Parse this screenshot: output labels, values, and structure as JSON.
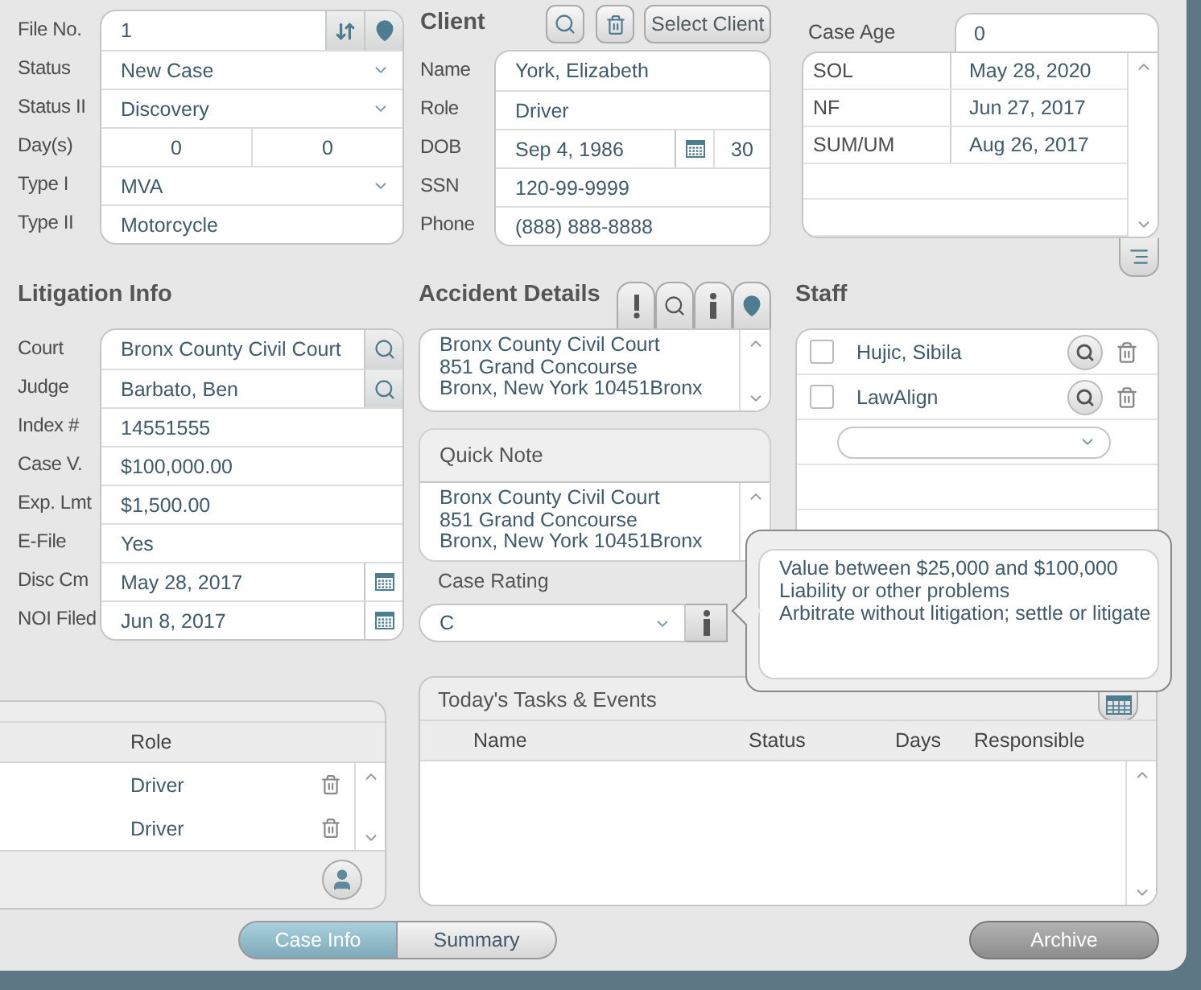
{
  "case": {
    "fields": [
      {
        "label": "File No.",
        "kind": "file",
        "value": "1"
      },
      {
        "label": "Status",
        "kind": "select",
        "value": "New Case"
      },
      {
        "label": "Status II",
        "kind": "select",
        "value": "Discovery"
      },
      {
        "label": "Day(s)",
        "kind": "pair",
        "value": "0",
        "value_2": "0"
      },
      {
        "label": "Type I",
        "kind": "select",
        "value": "MVA"
      },
      {
        "label": "Type II",
        "kind": "text",
        "value": "Motorcycle"
      }
    ]
  },
  "client": {
    "title": "Client",
    "select_button": "Select Client",
    "fields": [
      {
        "label": "Name",
        "kind": "text",
        "value": "York, Elizabeth"
      },
      {
        "label": "Role",
        "kind": "text",
        "value": "Driver"
      },
      {
        "label": "DOB",
        "kind": "dob",
        "value": "Sep 4, 1986",
        "value_2": "30"
      },
      {
        "label": "SSN",
        "kind": "text",
        "value": "120-99-9999"
      },
      {
        "label": "Phone",
        "kind": "text",
        "value": "(888) 888-8888"
      }
    ]
  },
  "deadlines": {
    "case_age_label": "Case Age",
    "case_age": "0",
    "rows": [
      {
        "label": "SOL",
        "date": "May 28, 2020"
      },
      {
        "label": "NF",
        "date": "Jun 27, 2017"
      },
      {
        "label": "SUM/UM",
        "date": "Aug 26, 2017"
      }
    ]
  },
  "litigation": {
    "title": "Litigation Info",
    "fields": [
      {
        "label": "Court",
        "kind": "lookup",
        "value": "Bronx County Civil Court"
      },
      {
        "label": "Judge",
        "kind": "lookup",
        "value": "Barbato, Ben"
      },
      {
        "label": "Index #",
        "kind": "text",
        "value": "14551555"
      },
      {
        "label": "Case V.",
        "kind": "text",
        "value": "$100,000.00"
      },
      {
        "label": "Exp. Lmt",
        "kind": "text",
        "value": "$1,500.00"
      },
      {
        "label": "E-File",
        "kind": "text",
        "value": "Yes"
      },
      {
        "label": "Disc Cm",
        "kind": "date",
        "value": "May 28, 2017"
      },
      {
        "label": "NOI Filed",
        "kind": "date",
        "value": "Jun 8, 2017"
      }
    ]
  },
  "accident": {
    "title": "Accident Details",
    "address": [
      "Bronx County Civil Court",
      "851 Grand Concourse",
      "Bronx, New York 10451Bronx"
    ]
  },
  "quick_note": {
    "title": "Quick Note",
    "lines": [
      "Bronx County Civil Court",
      "851 Grand Concourse",
      "Bronx, New York 10451Bronx"
    ]
  },
  "case_rating": {
    "label": "Case Rating",
    "value": "C"
  },
  "rating_tooltip": {
    "lines": [
      "Value between $25,000 and $100,000",
      "Liability or other problems",
      "Arbitrate without litigation; settle or litigate"
    ]
  },
  "staff": {
    "title": "Staff",
    "members": [
      {
        "name": "Hujic, Sibila",
        "checked": false
      },
      {
        "name": "LawAlign",
        "checked": false
      }
    ]
  },
  "parties": {
    "column": "Role",
    "rows": [
      {
        "role": "Driver"
      },
      {
        "role": "Driver"
      }
    ]
  },
  "tasks": {
    "title": "Today's Tasks & Events",
    "columns": [
      "Name",
      "Status",
      "Days",
      "Responsible"
    ]
  },
  "tabs": [
    {
      "label": "Case Info",
      "selected": true
    },
    {
      "label": "Summary",
      "selected": false
    }
  ],
  "archive_button": "Archive"
}
